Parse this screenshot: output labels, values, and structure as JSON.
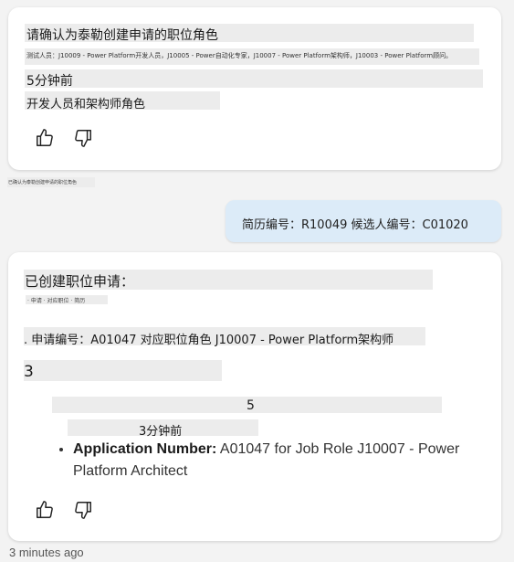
{
  "card1": {
    "heading": "请确认为泰勒创建申请的职位角色",
    "roles_line": "测试人员：J10009 - Power Platform开发人员，J10005 - Power自动化专家，J10007 - Power Platform架构师，J10003 - Power Platform顾问。",
    "time_label": "5分钟前",
    "role_text": "开发人员和架构师角色"
  },
  "hint_text": "已确认为泰勒创建申请的职位角色",
  "user_message": {
    "text": "简历编号：R10049 候选人编号：C01020"
  },
  "card2": {
    "heading": "已创建职位申请：",
    "sub_line": "· 申请 · 对应职位 · 简历",
    "application_line": ". 申请编号：A01047 对应职位角色 J10007 - Power Platform架构师",
    "count_3": "3",
    "count_5": "5",
    "time_label": "3分钟前",
    "bullet_label": "Application Number:",
    "bullet_value": " A01047 for Job Role J10007 - Power Platform Architect"
  },
  "footer_timestamp": "3 minutes ago",
  "icons": {
    "like": "thumbs-up-icon",
    "dislike": "thumbs-down-icon"
  }
}
